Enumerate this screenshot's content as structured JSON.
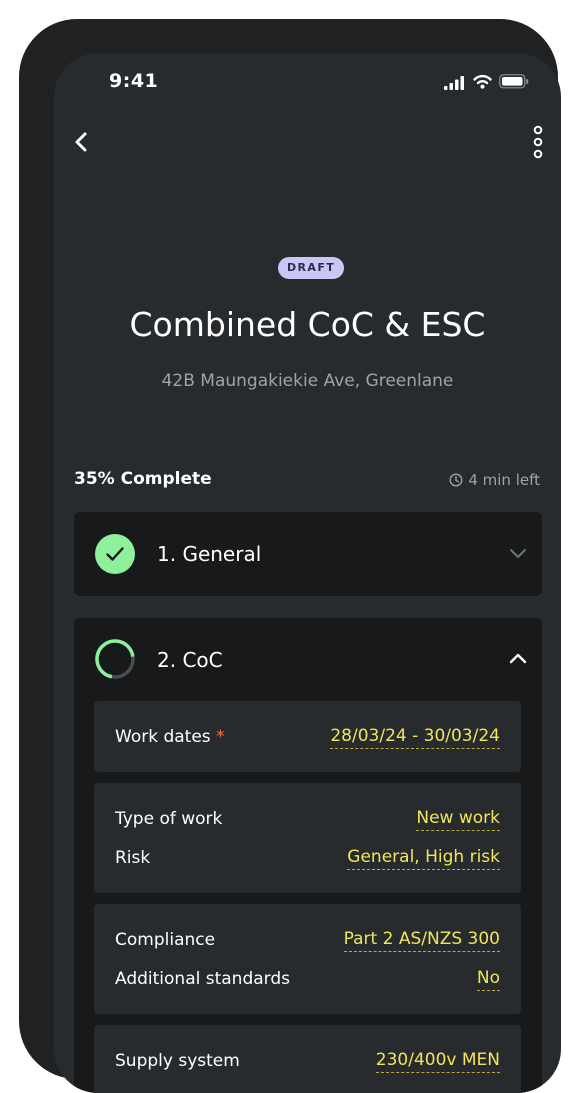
{
  "status_bar": {
    "time": "9:41"
  },
  "header": {
    "badge": "DRAFT",
    "title": "Combined CoC & ESC",
    "address": "42B Maungakiekie Ave, Greenlane"
  },
  "progress": {
    "label": "35% Complete",
    "percent": 35,
    "time_left": "4 min left"
  },
  "sections": [
    {
      "title": "1. General",
      "status": "complete",
      "expanded": false
    },
    {
      "title": "2. CoC",
      "status": "in-progress",
      "expanded": true
    }
  ],
  "coc": {
    "work_dates": {
      "label": "Work dates",
      "required_mark": "*",
      "value": "28/03/24 - 30/03/24"
    },
    "type_of_work": {
      "label": "Type of work",
      "value": "New work"
    },
    "risk": {
      "label": "Risk",
      "value": "General, High risk"
    },
    "compliance": {
      "label": "Compliance",
      "value": "Part 2 AS/NZS 300"
    },
    "additional_standards": {
      "label": "Additional standards",
      "value": "No"
    },
    "supply_system": {
      "label": "Supply system",
      "value": "230/400v MEN"
    }
  },
  "colors": {
    "accent_green": "#8ff09b",
    "value_yellow": "#f2e45c",
    "badge_bg": "#c9c7f6",
    "required_orange": "#ef7a52"
  },
  "icons": [
    "signal-icon",
    "wifi-icon",
    "battery-icon",
    "back-chevron-icon",
    "more-vertical-icon",
    "clock-icon",
    "check-icon",
    "chevron-down-icon",
    "chevron-up-icon",
    "progress-ring-icon"
  ]
}
